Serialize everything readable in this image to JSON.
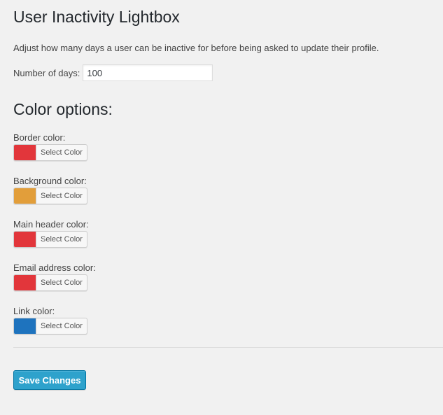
{
  "page": {
    "title": "User Inactivity Lightbox",
    "description": "Adjust how many days a user can be inactive for before being asked to update their profile."
  },
  "days": {
    "label": "Number of days:",
    "value": "100"
  },
  "color_options": {
    "heading": "Color options:",
    "fields": [
      {
        "label": "Border color:",
        "button": "Select Color",
        "color": "#e2363b"
      },
      {
        "label": "Background color:",
        "button": "Select Color",
        "color": "#e29e3a"
      },
      {
        "label": "Main header color:",
        "button": "Select Color",
        "color": "#e2363b"
      },
      {
        "label": "Email address color:",
        "button": "Select Color",
        "color": "#e2363b"
      },
      {
        "label": "Link color:",
        "button": "Select Color",
        "color": "#1e73be"
      }
    ]
  },
  "actions": {
    "save_label": "Save Changes"
  }
}
